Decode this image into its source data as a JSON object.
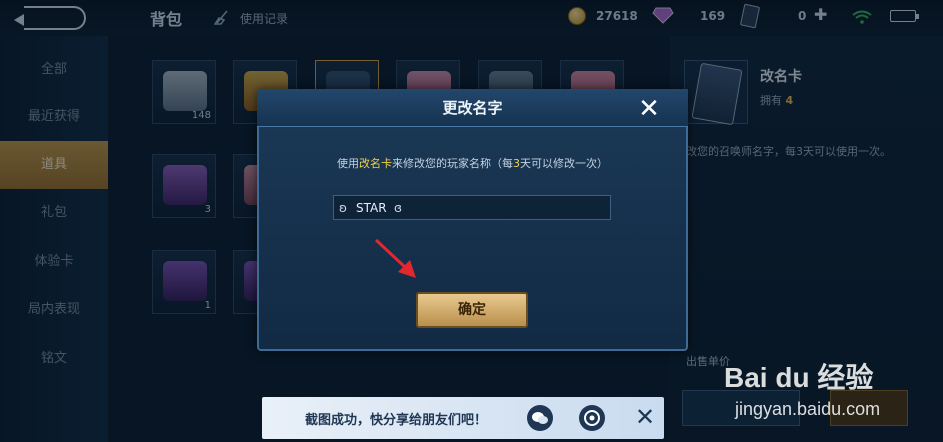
{
  "header": {
    "title": "背包",
    "history_label": "使用记录",
    "coins": "27618",
    "diamonds": "169",
    "cards": "0"
  },
  "sidebar": {
    "items": [
      {
        "label": "全部"
      },
      {
        "label": "最近获得"
      },
      {
        "label": "道具"
      },
      {
        "label": "礼包"
      },
      {
        "label": "体验卡"
      },
      {
        "label": "局内表现"
      },
      {
        "label": "铭文"
      }
    ],
    "active_index": 2
  },
  "grid": {
    "quantities": [
      "148",
      "3",
      "1"
    ]
  },
  "detail": {
    "name": "改名卡",
    "owned_label": "拥有",
    "owned_count": "4",
    "description": "改您的召唤师名字，每3天可以使用一次。",
    "sell_label": "出售单价"
  },
  "dialog": {
    "title": "更改名字",
    "message_prefix": "使用",
    "message_item": "改名卡",
    "message_middle": "来修改您的玩家名称（每",
    "message_days": "3",
    "message_suffix": "天可以修改一次）",
    "input_value": "STAR",
    "confirm_label": "确定"
  },
  "toast": {
    "text": "截图成功，快分享给朋友们吧！"
  },
  "watermark": {
    "main": "Bai du 经验",
    "sub": "jingyan.baidu.com"
  },
  "colors": {
    "accent_gold": "#c29a4e",
    "highlight_yellow": "#f0d24a",
    "arrow_red": "#e0282e"
  }
}
